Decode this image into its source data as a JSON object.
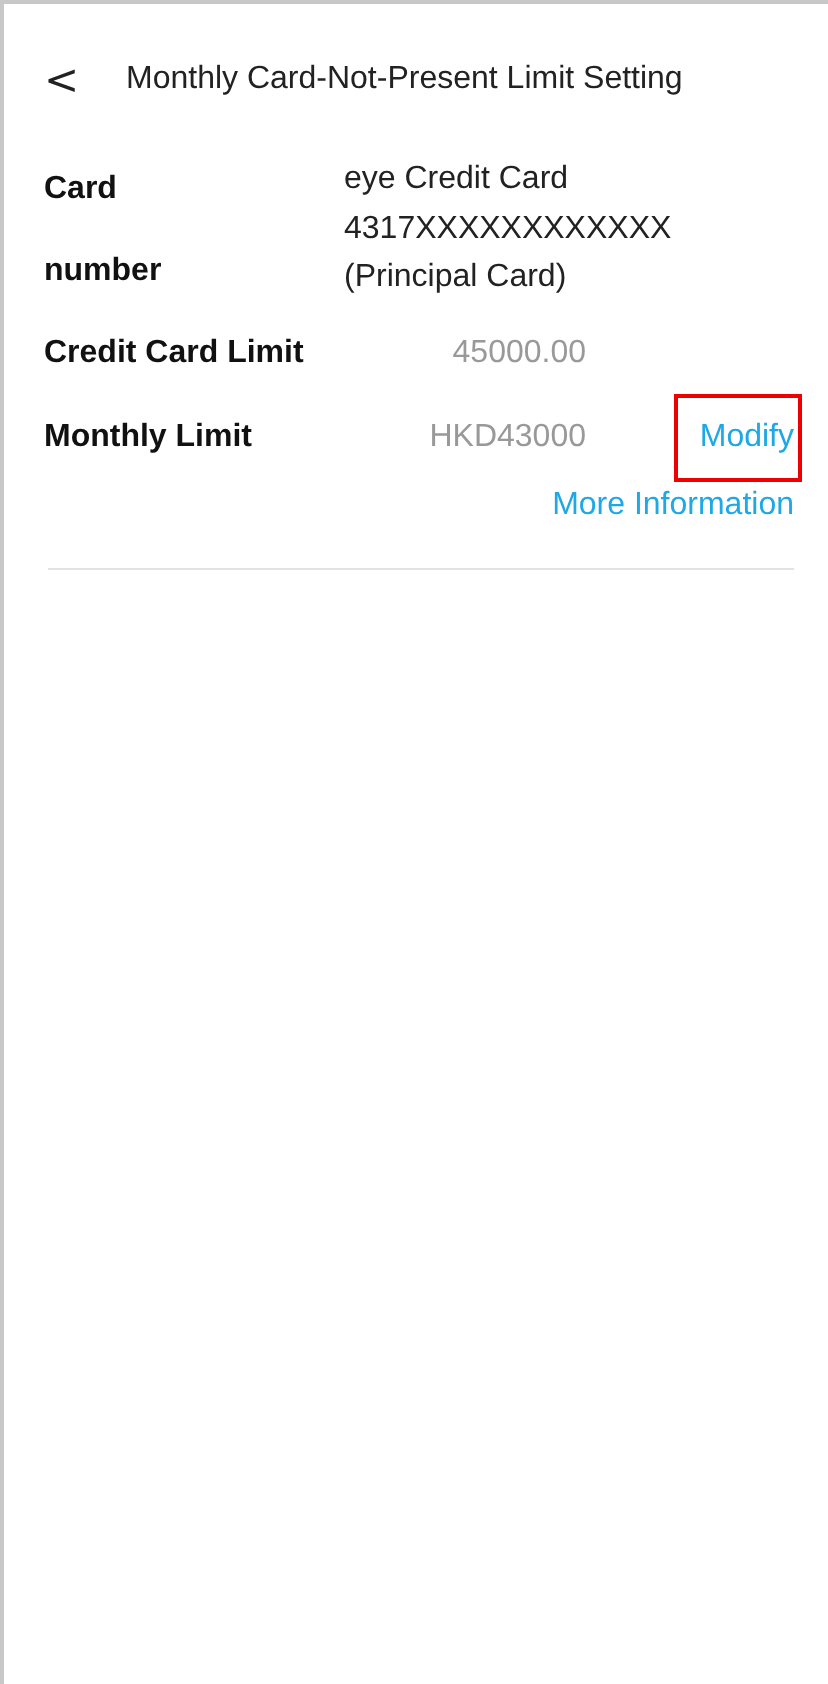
{
  "header": {
    "back": "<",
    "title": "Monthly Card-Not-Present Limit Setting"
  },
  "card": {
    "label": "Card number",
    "lines": [
      "eye Credit Card",
      "4317XXXXXXXXXXXX",
      "(Principal Card)"
    ]
  },
  "rows": [
    {
      "label": "Credit Card Limit",
      "value": "45000.00"
    },
    {
      "label": "Monthly Limit",
      "value": "HKD43000",
      "action": {
        "text": "Modify",
        "highlighted": true
      }
    }
  ],
  "more_link": "More Information"
}
